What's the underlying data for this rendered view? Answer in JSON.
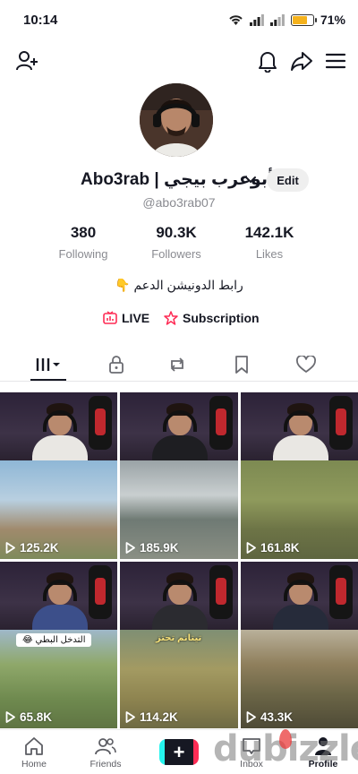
{
  "status_bar": {
    "time": "10:14",
    "battery": "71%",
    "battery_level": 0.71
  },
  "top_nav": {
    "icons": [
      "add-user-icon",
      "bell-icon",
      "share-icon",
      "menu-icon"
    ]
  },
  "profile": {
    "display_name": "Abo3rab | أبوعرب بيجي",
    "edit_label": "Edit",
    "username": "@abo3rab07",
    "stats": [
      {
        "value": "380",
        "label": "Following"
      },
      {
        "value": "90.3K",
        "label": "Followers"
      },
      {
        "value": "142.1K",
        "label": "Likes"
      }
    ],
    "bio": "رابط الدونيشن الدعم 👇",
    "live_label": "LIVE",
    "subscription_label": "Subscription"
  },
  "tabs": [
    "videos-tab",
    "private-tab",
    "reposts-tab",
    "favorites-tab",
    "liked-tab"
  ],
  "videos": [
    {
      "views": "125.2K"
    },
    {
      "views": "185.9K"
    },
    {
      "views": "161.8K"
    },
    {
      "views": "65.8K",
      "caption": "التدخل البطي 😂"
    },
    {
      "views": "114.2K",
      "caption": "تيتانم تحتز"
    },
    {
      "views": "43.3K"
    }
  ],
  "bottom_nav": {
    "home": "Home",
    "friends": "Friends",
    "inbox": "Inbox",
    "profile": "Profile"
  },
  "watermark": "dubizzle",
  "colors": {
    "live_red": "#fe2c55",
    "text": "#161823",
    "muted": "#8a8b91"
  }
}
